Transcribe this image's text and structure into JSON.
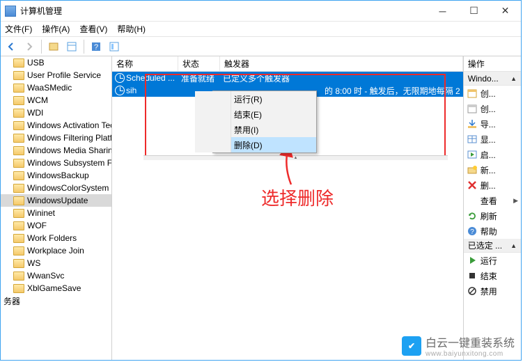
{
  "title": "计算机管理",
  "menubar": [
    "文件(F)",
    "操作(A)",
    "查看(V)",
    "帮助(H)"
  ],
  "tree": {
    "items": [
      "USB",
      "User Profile Service",
      "WaaSMedic",
      "WCM",
      "WDI",
      "Windows Activation Tec",
      "Windows Filtering Platf",
      "Windows Media Sharin",
      "Windows Subsystem Fo",
      "WindowsBackup",
      "WindowsColorSystem",
      "WindowsUpdate",
      "Wininet",
      "WOF",
      "Work Folders",
      "Workplace Join",
      "WS",
      "WwanSvc",
      "XblGameSave"
    ],
    "extra": "务器",
    "selected_index": 11
  },
  "list": {
    "headers": {
      "name": "名称",
      "status": "状态",
      "trigger": "触发器"
    },
    "rows": [
      {
        "name": "Scheduled ...",
        "status": "准备就绪",
        "trigger": "已定义多个触发器"
      },
      {
        "name": "sih",
        "status": "",
        "trigger": "的 8:00 时 - 触发后，无限期地每隔 2"
      }
    ]
  },
  "context_menu": {
    "items": [
      "运行(R)",
      "结束(E)",
      "禁用(I)",
      "删除(D)"
    ],
    "selected_index": 3
  },
  "annotation": "选择删除",
  "actions": {
    "title": "操作",
    "section1": "Windo...",
    "items1": [
      {
        "icon": "calendar",
        "label": "创..."
      },
      {
        "icon": "calendar-plain",
        "label": "创..."
      },
      {
        "icon": "import",
        "label": "导..."
      },
      {
        "icon": "table",
        "label": "显..."
      },
      {
        "icon": "enable",
        "label": "启..."
      },
      {
        "icon": "folder-new",
        "label": "新..."
      },
      {
        "icon": "delete",
        "label": "删..."
      },
      {
        "icon": "view",
        "label": "查看",
        "sub": "▶"
      },
      {
        "icon": "refresh",
        "label": "刷新"
      },
      {
        "icon": "help",
        "label": "帮助"
      }
    ],
    "section2": "已选定 ...",
    "items2": [
      {
        "icon": "run",
        "label": "运行"
      },
      {
        "icon": "stop",
        "label": "结束"
      },
      {
        "icon": "disable",
        "label": "禁用"
      }
    ]
  },
  "watermark": {
    "cn": "白云一键重装系统",
    "site": "www.baiyunxitong.com"
  }
}
